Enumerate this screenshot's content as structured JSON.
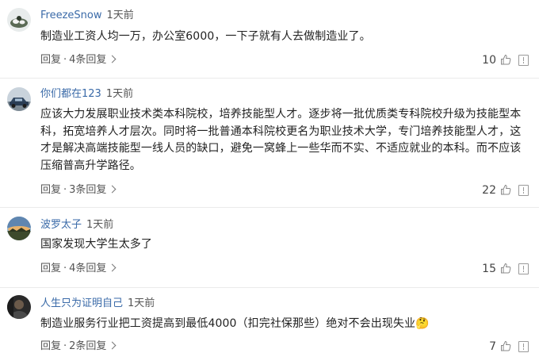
{
  "comments": [
    {
      "user": "FreezeSnow",
      "time": "1天前",
      "text": "制造业工资人均一万，办公室6000，一下子就有人去做制造业了。",
      "reply": "回复",
      "replies": "4条回复",
      "likes": "10",
      "avatar_icon": "avatar-snowy-landscape"
    },
    {
      "user": "你们都在123",
      "time": "1天前",
      "text": "应该大力发展职业技术类本科院校，培养技能型人才。逐步将一批优质类专科院校升级为技能型本科，拓宽培养人才层次。同时将一批普通本科院校更名为职业技术大学，专门培养技能型人才，这才是解决高端技能型一线人员的缺口，避免一窝蜂上一些华而不实、不适应就业的本科。而不应该压缩普高升学路径。",
      "reply": "回复",
      "replies": "3条回复",
      "likes": "22",
      "avatar_icon": "avatar-car"
    },
    {
      "user": "波罗太子",
      "time": "1天前",
      "text": "国家发现大学生太多了",
      "reply": "回复",
      "replies": "4条回复",
      "likes": "15",
      "avatar_icon": "avatar-sunset"
    },
    {
      "user": "人生只为证明自己",
      "time": "1天前",
      "text": "制造业服务行业把工资提高到最低4000（扣完社保那些）绝对不会出现失业",
      "emoji": "🤔",
      "reply": "回复",
      "replies": "2条回复",
      "likes": "7",
      "avatar_icon": "avatar-dark-portrait"
    }
  ],
  "separator": "·",
  "colors": {
    "username": "#3a6aa8",
    "meta": "#555555",
    "text": "#222222",
    "divider": "#ebebeb"
  }
}
